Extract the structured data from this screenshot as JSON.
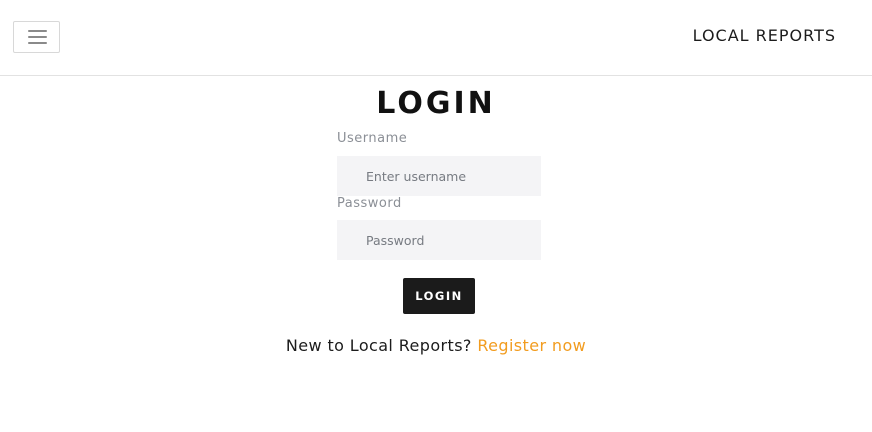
{
  "navbar": {
    "brand": "LOCAL REPORTS"
  },
  "login": {
    "title": "LOGIN",
    "username_label": "Username",
    "username_placeholder": "Enter username",
    "username_value": "",
    "password_label": "Password",
    "password_placeholder": "Password",
    "password_value": "",
    "submit_label": "LOGIN"
  },
  "register": {
    "prompt": "New to Local Reports?",
    "link_label": "Register now",
    "link_color": "#f29c1f"
  },
  "icons": {
    "menu_toggle": "hamburger-menu-icon"
  }
}
